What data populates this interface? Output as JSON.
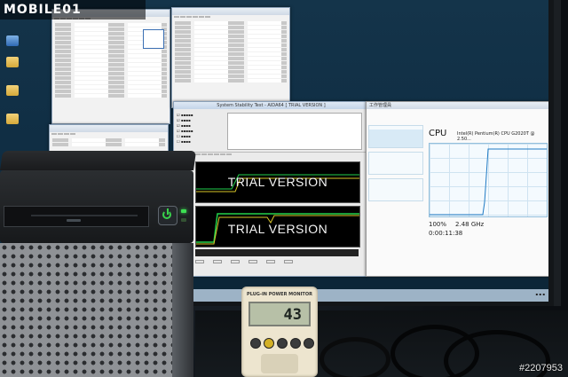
{
  "site_logo": "MOBILE01",
  "watermark": "#2207953",
  "aida": {
    "title": "System Stability Test - AIDA64 [ TRIAL VERSION ]",
    "trial_text": "TRIAL VERSION"
  },
  "task_manager": {
    "title": "工作管理員",
    "cpu_label": "CPU",
    "cpu_model": "Intel(R) Pentium(R) CPU G2020T @ 2.50...",
    "utilization": "100%",
    "speed": "2.48 GHz",
    "uptime": "0:00:11:38"
  },
  "power_meter": {
    "title": "PLUG-IN POWER MONITOR",
    "reading": "43"
  }
}
